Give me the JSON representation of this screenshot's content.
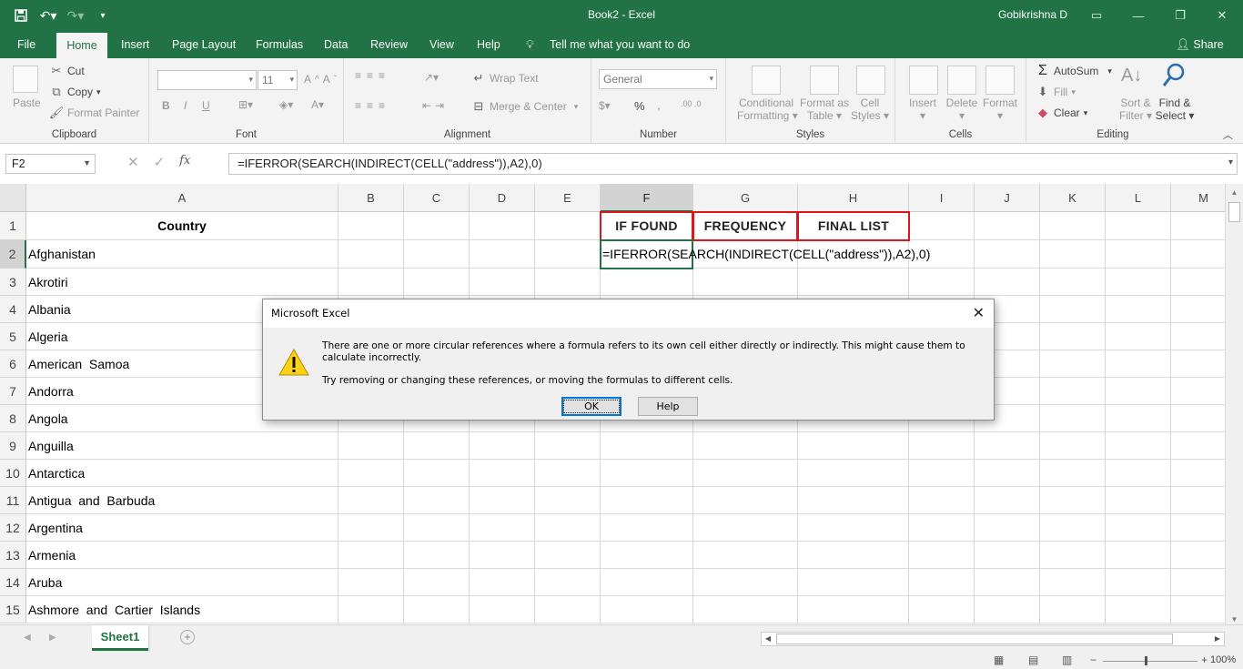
{
  "window": {
    "title": "Book2 - Excel",
    "user": "Gobikrishna D",
    "accent": "#217346"
  },
  "qat": {
    "icons": [
      "save-icon",
      "undo-icon",
      "redo-icon",
      "customize-icon"
    ]
  },
  "tabs": [
    "File",
    "Home",
    "Insert",
    "Page Layout",
    "Formulas",
    "Data",
    "Review",
    "View",
    "Help"
  ],
  "active_tab": "Home",
  "tellme": "Tell me what you want to do",
  "share": "Share",
  "ribbon": {
    "clipboard": {
      "label": "Clipboard",
      "paste": "Paste",
      "cut": "Cut",
      "copy": "Copy",
      "format_painter": "Format Painter"
    },
    "font": {
      "label": "Font",
      "size": "11",
      "bold": "B",
      "italic": "I",
      "underline": "U"
    },
    "alignment": {
      "label": "Alignment",
      "wrap_text": "Wrap Text",
      "merge_center": "Merge & Center"
    },
    "number": {
      "label": "Number",
      "format": "General",
      "percent": "%",
      "comma": ","
    },
    "styles": {
      "label": "Styles",
      "conditional_1": "Conditional",
      "conditional_2": "Formatting",
      "format_table_1": "Format as",
      "format_table_2": "Table",
      "cell_styles_1": "Cell",
      "cell_styles_2": "Styles"
    },
    "cells": {
      "label": "Cells",
      "insert": "Insert",
      "delete": "Delete",
      "format": "Format"
    },
    "editing": {
      "label": "Editing",
      "autosum": "AutoSum",
      "fill": "Fill",
      "clear": "Clear",
      "sort_1": "Sort &",
      "sort_2": "Filter",
      "find_1": "Find &",
      "find_2": "Select"
    }
  },
  "formula_bar": {
    "name_box": "F2",
    "fx": "fx",
    "formula": "=IFERROR(SEARCH(INDIRECT(CELL(\"address\")),A2),0)"
  },
  "columns": [
    "A",
    "B",
    "C",
    "D",
    "E",
    "F",
    "G",
    "H",
    "I",
    "J",
    "K",
    "L",
    "M"
  ],
  "rows": [
    "1",
    "2",
    "3",
    "4",
    "5",
    "6",
    "7",
    "8",
    "9",
    "10",
    "11",
    "12",
    "13",
    "14",
    "15"
  ],
  "cells": {
    "A1": "Country",
    "F1": "IF  FOUND",
    "G1": "FREQUENCY",
    "H1": "FINAL  LIST",
    "F2": "=IFERROR(SEARCH(INDIRECT(CELL(\"address\")),A2),0)",
    "countries": [
      "Afghanistan",
      "Akrotiri",
      "Albania",
      "Algeria",
      "American  Samoa",
      "Andorra",
      "Angola",
      "Anguilla",
      "Antarctica",
      "Antigua  and  Barbuda",
      "Argentina",
      "Armenia",
      "Aruba",
      "Ashmore  and  Cartier  Islands"
    ]
  },
  "sheets": [
    "Sheet1"
  ],
  "status": {
    "zoom": "100%"
  },
  "dialog": {
    "title": "Microsoft Excel",
    "message": "There are one or more circular references where a formula refers to its own cell either directly or indirectly. This might cause them to calculate incorrectly.",
    "hint": "Try removing or changing these references, or moving the formulas to different cells.",
    "ok": "OK",
    "help": "Help"
  }
}
